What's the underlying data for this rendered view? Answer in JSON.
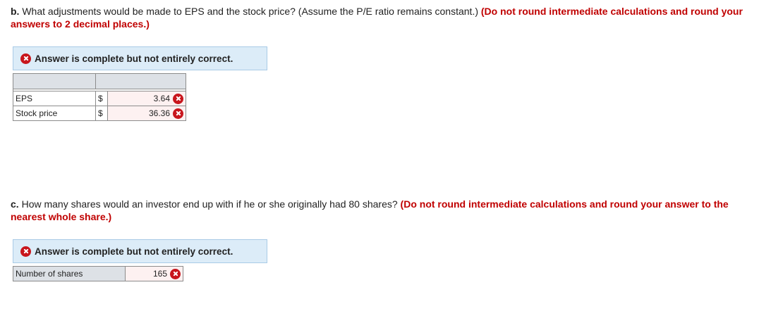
{
  "part_b": {
    "lead": "b.",
    "question": "What adjustments would be made to EPS and the stock price? (Assume the P/E ratio remains constant.)",
    "instruction": "(Do not round intermediate calculations and round your answers to 2 decimal places.)",
    "banner": "Answer is complete but not entirely correct.",
    "rows": [
      {
        "label": "EPS",
        "currency": "$",
        "value": "3.64",
        "status": "incorrect"
      },
      {
        "label": "Stock price",
        "currency": "$",
        "value": "36.36",
        "status": "incorrect"
      }
    ]
  },
  "part_c": {
    "lead": "c.",
    "question": "How many shares would an investor end up with if he or she originally had 80 shares?",
    "instruction": "(Do not round intermediate calculations and round your answer to the nearest whole share.)",
    "banner": "Answer is complete but not entirely correct.",
    "row": {
      "label": "Number of shares",
      "value": "165",
      "status": "incorrect"
    }
  },
  "colors": {
    "error_red": "#c8161d",
    "instruction_red": "#c00000",
    "banner_bg": "#dcecf8"
  },
  "icons": {
    "status_incorrect": "x-circle-icon"
  }
}
